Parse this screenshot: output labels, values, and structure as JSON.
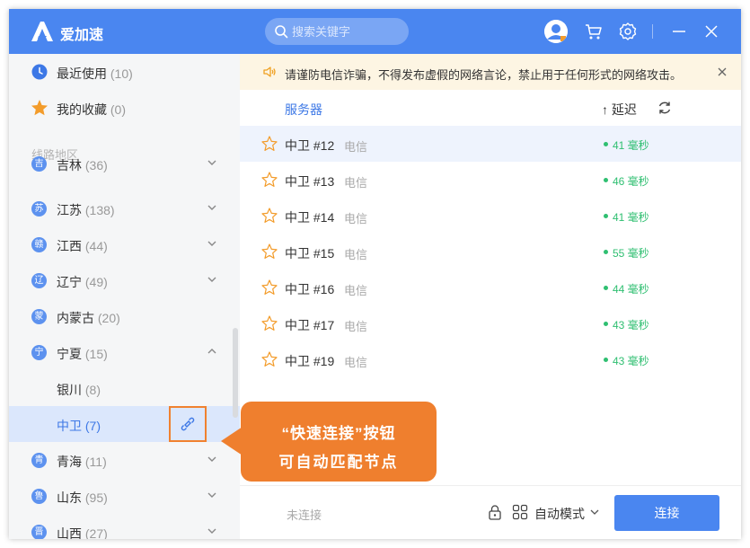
{
  "app": {
    "name": "爱加速"
  },
  "search": {
    "placeholder": "搜索关键字"
  },
  "sidebar": {
    "top_items": [
      {
        "label": "最近使用",
        "count": "(10)"
      },
      {
        "label": "我的收藏",
        "count": "(0)"
      }
    ],
    "section_title": "线路地区",
    "regions": [
      {
        "badge": "吉",
        "label": "吉林",
        "count": "(36)"
      },
      {
        "badge": "苏",
        "label": "江苏",
        "count": "(138)"
      },
      {
        "badge": "赣",
        "label": "江西",
        "count": "(44)"
      },
      {
        "badge": "辽",
        "label": "辽宁",
        "count": "(49)"
      },
      {
        "badge": "蒙",
        "label": "内蒙古",
        "count": "(20)"
      },
      {
        "badge": "宁",
        "label": "宁夏",
        "count": "(15)"
      },
      {
        "badge": "青",
        "label": "青海",
        "count": "(11)"
      },
      {
        "badge": "鲁",
        "label": "山东",
        "count": "(95)"
      },
      {
        "badge": "晋",
        "label": "山西",
        "count": "(27)"
      }
    ],
    "cities": [
      {
        "label": "银川",
        "count": "(8)"
      },
      {
        "label": "中卫",
        "count": "(7)"
      }
    ]
  },
  "notice": {
    "text": "请谨防电信诈骗，不得发布虚假的网络言论，禁止用于任何形式的网络攻击。"
  },
  "list_header": {
    "server": "服务器",
    "delay": "↑ 延迟"
  },
  "servers": [
    {
      "name": "中卫 #12",
      "isp": "电信",
      "latency": "41 毫秒"
    },
    {
      "name": "中卫 #13",
      "isp": "电信",
      "latency": "46 毫秒"
    },
    {
      "name": "中卫 #14",
      "isp": "电信",
      "latency": "41 毫秒"
    },
    {
      "name": "中卫 #15",
      "isp": "电信",
      "latency": "55 毫秒"
    },
    {
      "name": "中卫 #16",
      "isp": "电信",
      "latency": "44 毫秒"
    },
    {
      "name": "中卫 #17",
      "isp": "电信",
      "latency": "43 毫秒"
    },
    {
      "name": "中卫 #19",
      "isp": "电信",
      "latency": "43 毫秒"
    }
  ],
  "footer": {
    "status": "未连接",
    "mode": "自动模式",
    "connect": "连接"
  },
  "callout": {
    "line1": "“快速连接”按钮",
    "line2": "可自动匹配节点"
  },
  "colors": {
    "brand": "#4a86f0",
    "accent": "#ef7f2e",
    "latency": "#2fbf71"
  }
}
